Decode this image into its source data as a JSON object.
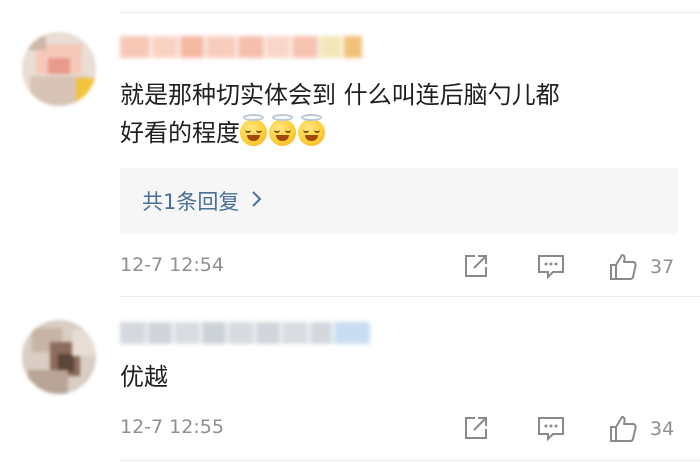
{
  "comments": [
    {
      "content_line1": "就是那种切实体会到 什么叫连后脑勺儿都",
      "content_line2": "好看的程度",
      "reply_link": "共1条回复",
      "timestamp": "12-7 12:54",
      "like_count": "37",
      "emoji_icons": [
        "halo-smile-icon",
        "halo-smile-icon",
        "halo-smile-icon"
      ]
    },
    {
      "content_line1": "优越",
      "timestamp": "12-7 12:55",
      "like_count": "34"
    }
  ],
  "icons": {
    "share": "share-icon",
    "comment": "comment-icon",
    "like": "thumbs-up-icon",
    "chevron": "chevron-right-icon"
  },
  "colors": {
    "link": "#4a6e96",
    "meta": "#8f8f8f",
    "reply_bg": "#f6f6f6"
  }
}
